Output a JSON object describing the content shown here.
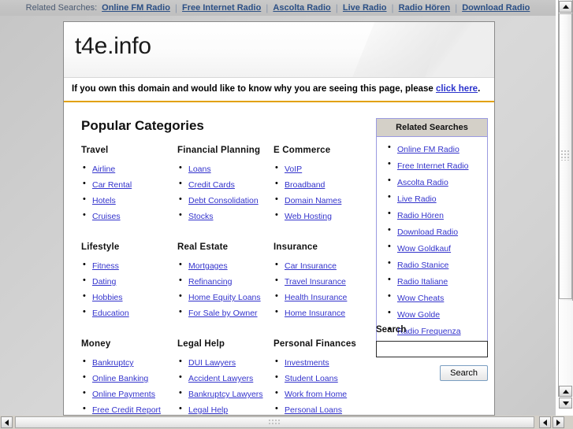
{
  "top_strip": {
    "label": "Related Searches:",
    "separator": "|",
    "links": [
      "Online FM Radio",
      "Free Internet Radio",
      "Ascolta Radio",
      "Live Radio",
      "Radio Hören",
      "Download Radio"
    ]
  },
  "header": {
    "domain": "t4e.info"
  },
  "notice": {
    "text_before": "If you own this domain and would like to know why you are seeing this page, please ",
    "link": "click here",
    "text_after": "."
  },
  "main": {
    "title": "Popular Categories",
    "category_rows": [
      [
        {
          "heading": "Travel",
          "links": [
            "Airline",
            "Car Rental",
            "Hotels",
            "Cruises"
          ]
        },
        {
          "heading": "Financial Planning",
          "links": [
            "Loans",
            "Credit Cards",
            "Debt Consolidation",
            "Stocks"
          ]
        },
        {
          "heading": "E Commerce",
          "links": [
            "VoIP",
            "Broadband",
            "Domain Names",
            "Web Hosting"
          ]
        }
      ],
      [
        {
          "heading": "Lifestyle",
          "links": [
            "Fitness",
            "Dating",
            "Hobbies",
            "Education"
          ]
        },
        {
          "heading": "Real Estate",
          "links": [
            "Mortgages",
            "Refinancing",
            "Home Equity Loans",
            "For Sale by Owner"
          ]
        },
        {
          "heading": "Insurance",
          "links": [
            "Car Insurance",
            "Travel Insurance",
            "Health Insurance",
            "Home Insurance"
          ]
        }
      ],
      [
        {
          "heading": "Money",
          "links": [
            "Bankruptcy",
            "Online Banking",
            "Online Payments",
            "Free Credit Report"
          ]
        },
        {
          "heading": "Legal Help",
          "links": [
            "DUI Lawyers",
            "Accident Lawyers",
            "Bankruptcy Lawyers",
            "Legal Help"
          ]
        },
        {
          "heading": "Personal Finances",
          "links": [
            "Investments",
            "Student Loans",
            "Work from Home",
            "Personal Loans"
          ]
        }
      ]
    ]
  },
  "sidebar": {
    "panel_title": "Related Searches",
    "links": [
      "Online FM Radio",
      "Free Internet Radio",
      "Ascolta Radio",
      "Live Radio",
      "Radio Hören",
      "Download Radio",
      "Wow Goldkauf",
      "Radio Stanice",
      "Radio Italiane",
      "Wow Cheats",
      "Wow Golde",
      "Radio Frequenza"
    ]
  },
  "search": {
    "label": "Search",
    "value": "",
    "placeholder": "",
    "button_label": "Search"
  },
  "colors": {
    "link": "#3333cc",
    "notice_rule": "#e2a100",
    "panel_border": "#9a9ae0",
    "panel_header_bg": "#d4d0c8",
    "page_bg": "#cfcfcf"
  }
}
